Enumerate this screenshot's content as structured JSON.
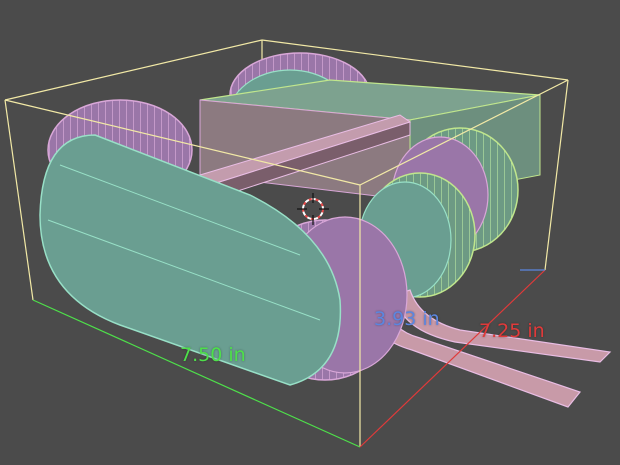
{
  "viewport": {
    "background": "#4b4b4b",
    "selection_outline_color": "#f2e9a6"
  },
  "dimensions": {
    "x": {
      "label": "7.50 in",
      "color": "#4ee04a"
    },
    "y": {
      "label": "3.93 in",
      "color": "#5b86e0"
    },
    "z": {
      "label": "7.25 in",
      "color": "#e03a3a"
    }
  },
  "model": {
    "body_color": "#6a9e91",
    "wheel_color": "#9a76a8",
    "tread_color": "#d9a7d8",
    "arm_color": "#c89aa8"
  },
  "icons": {
    "origin": "3d-cursor-icon"
  }
}
